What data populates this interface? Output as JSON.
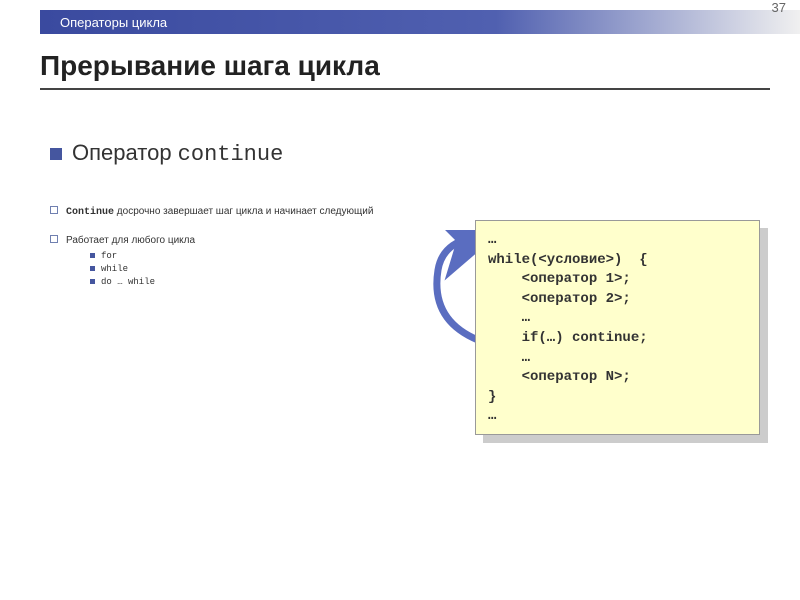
{
  "page_number": "37",
  "header": "Операторы цикла",
  "title": "Прерывание шага цикла",
  "main_bullet": {
    "prefix": "Оператор ",
    "code": "continue"
  },
  "sub1": {
    "kw": "Continue",
    "rest": " досрочно завершает шаг цикла и начинает следующий"
  },
  "sub2": "Работает для любого цикла",
  "loops": [
    "for",
    "while",
    "do … while"
  ],
  "code_lines": "…\nwhile(<условие>)  {\n    <оператор 1>;\n    <оператор 2>;\n    …\n    if(…) continue;\n    …\n    <оператор N>;\n}\n…"
}
